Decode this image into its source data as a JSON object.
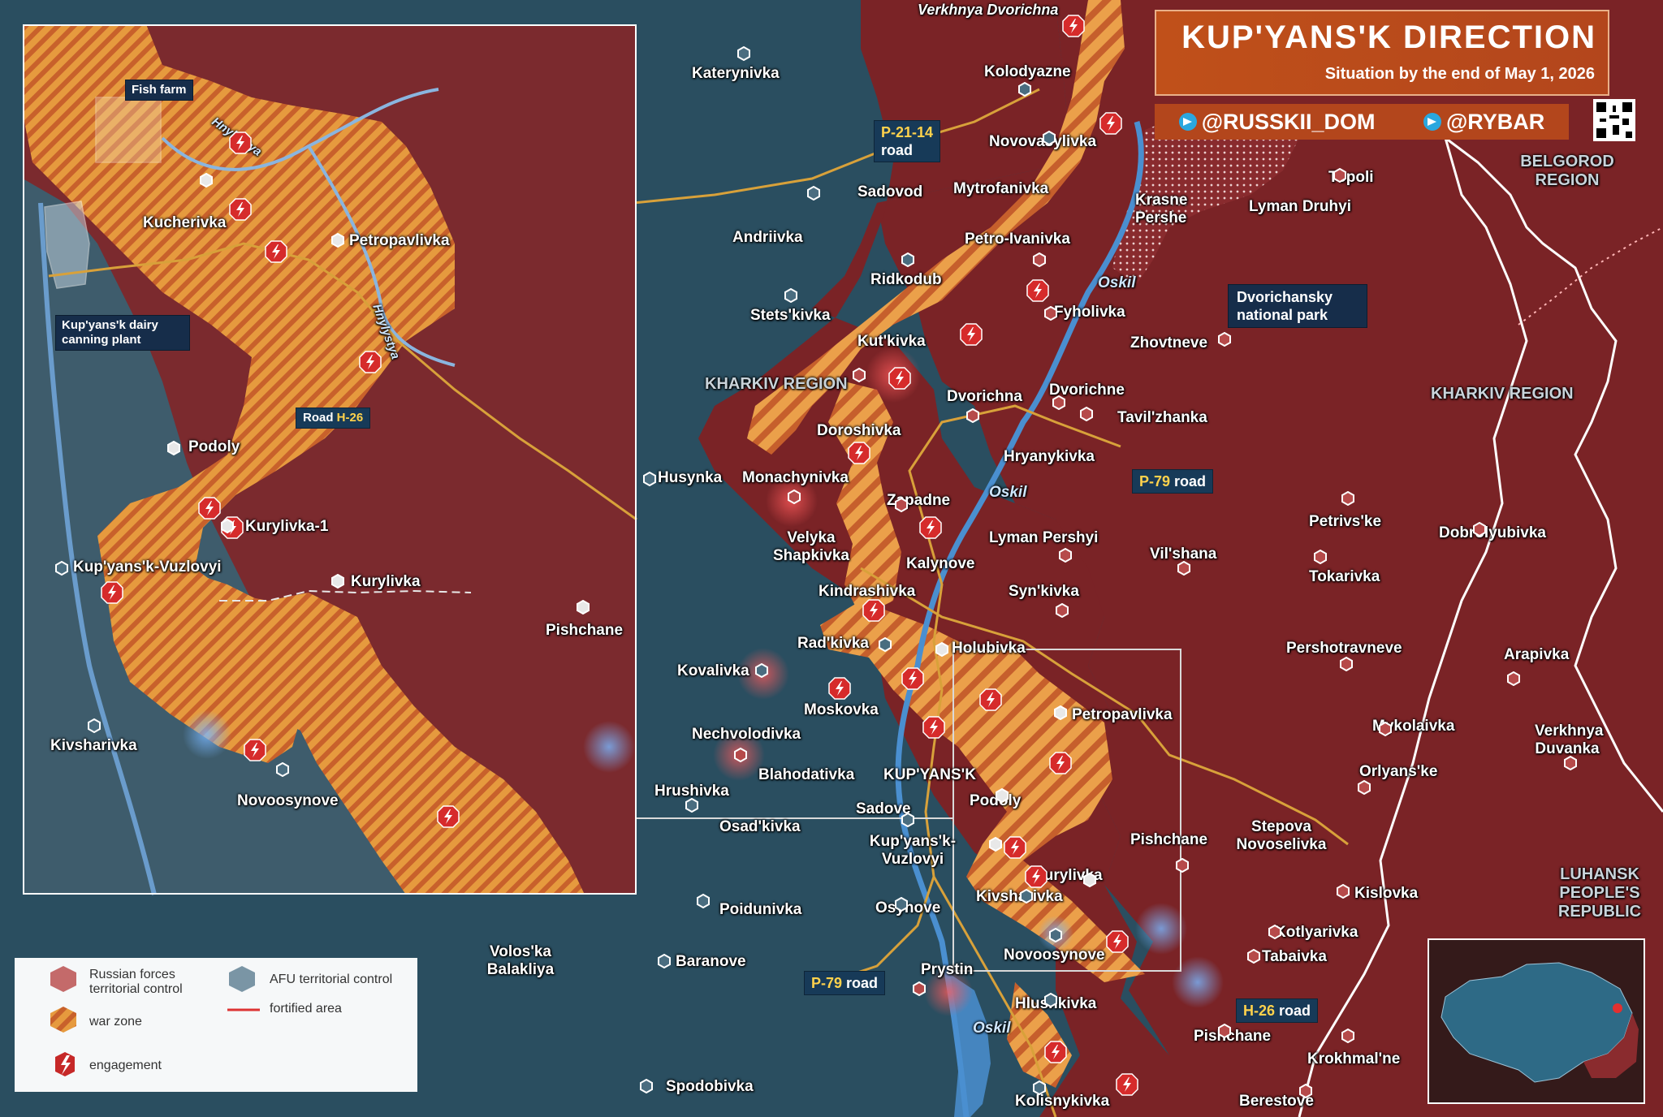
{
  "header": {
    "title": "KUP'YANS'K DIRECTION",
    "subtitle": "Situation by the end of May 1, 2026",
    "socials": [
      "@RUSSKII_DOM",
      "@RYBAR"
    ]
  },
  "colors": {
    "russian_control": "#7a2326",
    "afu_control": "#2d5a6e",
    "war_zone": "#e38a35",
    "title_bg": "#c0501a",
    "engagement": "#d62b2b"
  },
  "regions": [
    "KHARKIV REGION",
    "KHARKIV REGION",
    "BELGOROD REGION",
    "LUHANSK PEOPLE'S REPUBLIC"
  ],
  "rivers": {
    "main": [
      "Oskil",
      "Oskil",
      "Oskil"
    ],
    "inset": [
      "Hnylystya",
      "Hnylystya"
    ]
  },
  "roads": {
    "p2114": {
      "code": "P-21-14",
      "word": "road"
    },
    "p79_top": {
      "code": "P-79",
      "word": "road"
    },
    "p79_bottom": {
      "code": "P-79",
      "word": "road"
    },
    "h26": {
      "code": "H-26",
      "word": "road"
    },
    "inset_h26": {
      "word": "Road",
      "code": "H-26"
    }
  },
  "callouts": {
    "dvorichansky": "Dvorichansky national park",
    "fish_farm": "Fish farm",
    "dairy": "Kup'yans'k dairy canning plant"
  },
  "settlements_main": [
    "Verkhnya Dvorichna",
    "Katerynivka",
    "Kolodyazne",
    "Novovasylivka",
    "Sadovod",
    "Mytrofanivka",
    "Krasne Pershe",
    "Topoli",
    "Lyman Druhyi",
    "Andriivka",
    "Petro-Ivanivka",
    "Ridkodub",
    "Stets'kivka",
    "Fyholivka",
    "Kut'kivka",
    "Zhovtneve",
    "Dvorichna",
    "Dvorichne",
    "Tavil'zhanka",
    "Doroshivka",
    "Hryanykivka",
    "Husynka",
    "Monachynivka",
    "Zapadne",
    "Petrivs'ke",
    "Dobrolyubivka",
    "Velyka Shapkivka",
    "Lyman Pershyi",
    "Vil'shana",
    "Kalynove",
    "Tokarivka",
    "Kindrashivka",
    "Syn'kivka",
    "Rad'kivka",
    "Holubivka",
    "Pershotravneve",
    "Arapivka",
    "Kovalivka",
    "Moskovka",
    "Petropavlivka",
    "Nechvolodivka",
    "Mykolaivka",
    "Verkhnya Duvanka",
    "Blahodativka",
    "KUP'YANS'K",
    "Orlyans'ke",
    "Hrushivka",
    "Podoly",
    "Sadove",
    "Osad'kivka",
    "Stepova Novoselivka",
    "Pishchane",
    "Kup'yans'k-Vuzlovyi",
    "Kurylivka",
    "Kislovka",
    "Kivsharivka",
    "Poidunivka",
    "Osynove",
    "Kotlyarivka",
    "Volos'ka Balakliya",
    "Tabaivka",
    "Novoosynove",
    "Baranove",
    "Prystin",
    "Hlushkivka",
    "Pishchane",
    "Krokhmal'ne",
    "Spodobivka",
    "Kolisnykivka",
    "Berestove"
  ],
  "settlements_inset": [
    "Kucherivka",
    "Petropavlivka",
    "Podoly",
    "Kurylivka-1",
    "Kup'yans'k-Vuzlovyi",
    "Kurylivka",
    "Pishchane",
    "Kivsharivka",
    "Novoosynove"
  ],
  "legend": {
    "russian": "Russian forces territorial control",
    "afu": "AFU territorial control",
    "warzone": "war zone",
    "fortified": "fortified area",
    "engagement": "engagement"
  }
}
